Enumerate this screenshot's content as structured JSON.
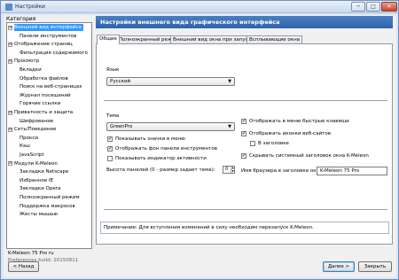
{
  "window": {
    "title": "Настройки",
    "min_glyph": "─",
    "max_glyph": "□",
    "close_glyph": "✕"
  },
  "left": {
    "category_label": "Категория",
    "tree": [
      {
        "label": "Внешний вид интерфейса",
        "exp": "⊟",
        "selected": true
      },
      {
        "label": "Панели инструментов"
      },
      {
        "label": "Отображение страниц",
        "exp": "⊟"
      },
      {
        "label": "Фильтрация содержимого"
      },
      {
        "label": "Просмотр",
        "exp": "⊟"
      },
      {
        "label": "Вкладки"
      },
      {
        "label": "Обработка файлов"
      },
      {
        "label": "Поиск на веб-страницах"
      },
      {
        "label": "Журнал посещений"
      },
      {
        "label": "Горячие ссылки"
      },
      {
        "label": "Приватность и защита",
        "exp": "⊟"
      },
      {
        "label": "Шифрование"
      },
      {
        "label": "Сеть/Поведение",
        "exp": "⊟"
      },
      {
        "label": "Прокси"
      },
      {
        "label": "Кэш"
      },
      {
        "label": "JavaScript"
      },
      {
        "label": "Модули K-Meleon",
        "exp": "⊟"
      },
      {
        "label": "Закладки Netscape"
      },
      {
        "label": "Избранное IE"
      },
      {
        "label": "Закладки Opera"
      },
      {
        "label": "Полноэкранный режим"
      },
      {
        "label": "Поддержка макросов"
      },
      {
        "label": "Жесты мышью"
      }
    ],
    "version": "K-Meleon 75 Pro ru",
    "build": "Preferences build: 20150811"
  },
  "header": {
    "title": "Настройки внешнего вида графического интерфейса"
  },
  "tabs": [
    {
      "label": "Общие",
      "active": true
    },
    {
      "label": "Полноэкранный режим"
    },
    {
      "label": "Внешний вид окна при запуске"
    },
    {
      "label": "Всплывающие окна"
    }
  ],
  "general": {
    "language_label": "Язык",
    "language_value": "Русский",
    "theme_label": "Тема",
    "theme_value": "GreenPro",
    "left_checks": [
      {
        "label": "Показывать значки в меню",
        "checked": true
      },
      {
        "label": "Отображать фон панели инструментов",
        "checked": true
      },
      {
        "label": "Показывать индикатор активности",
        "checked": false
      }
    ],
    "panel_height_label": "Высота панелей (0 - размер задает тема):",
    "panel_height_value": "0",
    "right_checks": [
      {
        "label": "Отображать в меню быстрые клавиши",
        "checked": true
      },
      {
        "label": "Отображать иконки веб-сайтов",
        "checked": true
      },
      {
        "label": "В заголовке",
        "checked": false
      },
      {
        "label": "Скрывать системный заголовок окна K-Meleon",
        "checked": true
      }
    ],
    "browser_name_label": "Имя браузера в заголовке окна:",
    "browser_name_value": "K-Meleon 75 Pro",
    "note": "Примечание: Для вступления изменений в силу необходим перезапуск K-Meleon."
  },
  "buttons": {
    "back": "< Назад",
    "next": "Далее >",
    "close": "Закрыть"
  },
  "icons": {
    "check": "✔",
    "dropdown": "▼",
    "spin_up": "▲",
    "spin_down": "▼"
  }
}
